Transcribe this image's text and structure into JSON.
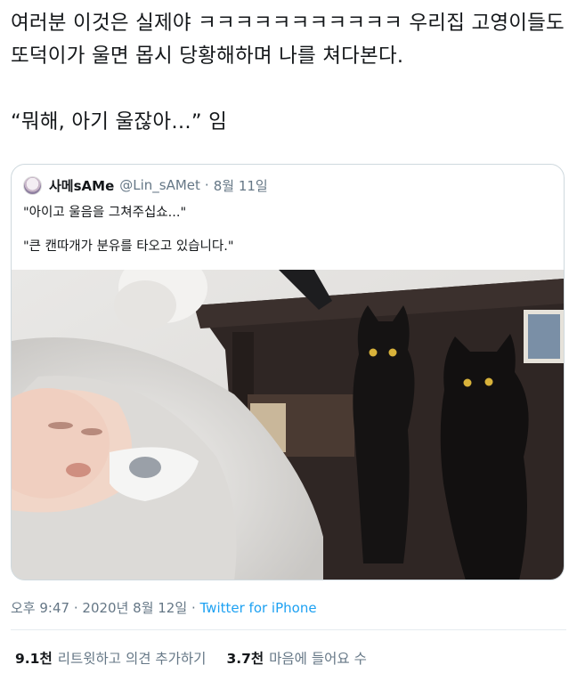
{
  "tweet": {
    "text": "여러분 이것은 실제야 ㅋㅋㅋㅋㅋㅋㅋㅋㅋㅋㅋ 우리집 고영이들도 또덕이가 울면 몹시 당황해하며 나를 쳐다본다.\n\n“뭐해, 아기 울잖아…” 임"
  },
  "quote": {
    "display_name": "사메sAMe",
    "handle": "@Lin_sAMet",
    "separator": "·",
    "date": "8월 11일",
    "line1": "\"아이고 울음을 그쳐주십쇼...\"",
    "line2": "\"큰 캔따개가 분유를 타오고 있습니다.\""
  },
  "meta": {
    "time": "오후 9:47",
    "separator1": "·",
    "date": "2020년 8월 12일",
    "separator2": "·",
    "source": "Twitter for iPhone"
  },
  "stats": {
    "retweets_count": "9.1천",
    "retweets_label": "리트윗하고 의견 추가하기",
    "likes_count": "3.7천",
    "likes_label": "마음에 들어요 수"
  },
  "colors": {
    "link": "#1da1f2",
    "muted": "#657786",
    "border": "#cfd9de"
  }
}
